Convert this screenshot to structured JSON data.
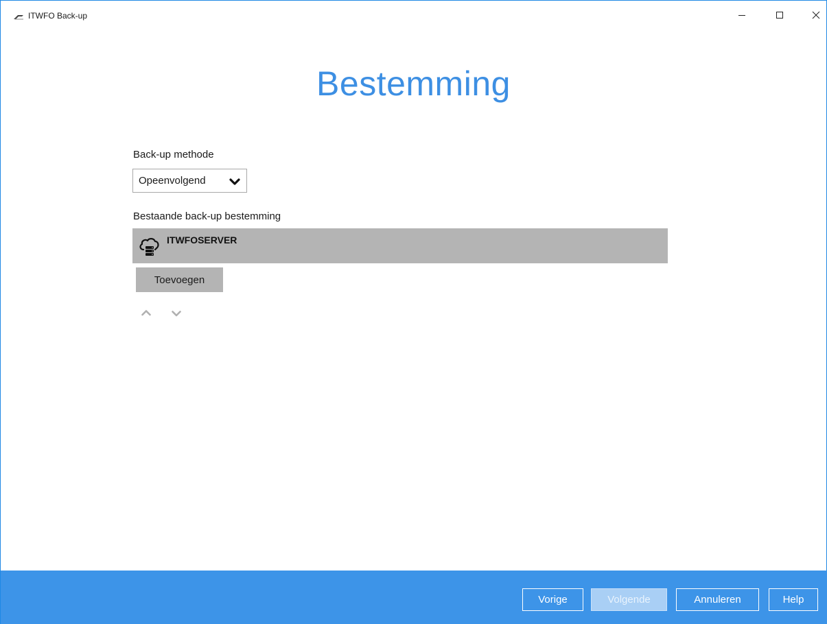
{
  "window": {
    "title": "ITWFO Back-up",
    "border_color": "#1e88e5"
  },
  "icons": {
    "app": "itwfo-logo-icon",
    "minimize": "minimize-icon",
    "maximize": "maximize-icon",
    "close": "close-icon",
    "dropdown": "chevron-down-icon",
    "destination": "cloud-server-icon",
    "move_up": "chevron-up-icon",
    "move_down": "chevron-down-icon"
  },
  "page": {
    "title": "Bestemming",
    "title_color": "#3d8fe3"
  },
  "backup_method": {
    "label": "Back-up methode",
    "selected": "Opeenvolgend"
  },
  "destinations": {
    "label": "Bestaande back-up bestemming",
    "items": [
      {
        "name": "ITWFOSERVER"
      }
    ],
    "add_label": "Toevoegen"
  },
  "footer": {
    "background": "#3d94e8",
    "buttons": {
      "previous": "Vorige",
      "next": "Volgende",
      "cancel": "Annuleren",
      "help": "Help"
    }
  }
}
